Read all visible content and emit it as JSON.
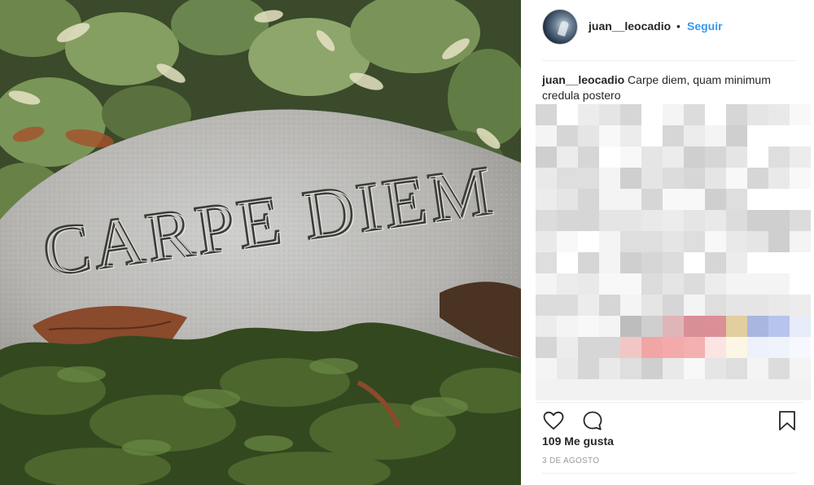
{
  "post": {
    "username": "juan__leocadio",
    "separator": "•",
    "follow_label": "Seguir",
    "caption_user": "juan__leocadio",
    "caption_text": "Carpe diem, quam minimum credula postero",
    "likes_text": "109 Me gusta",
    "date_text": "3 DE AGOSTO"
  },
  "photo": {
    "engraving": "CARPE DIEM"
  },
  "icons": {
    "like": "heart-outline-icon",
    "comment": "speech-bubble-icon",
    "save": "bookmark-icon"
  },
  "colors": {
    "link_blue": "#3897f0",
    "text": "#262626",
    "muted": "#999999"
  }
}
